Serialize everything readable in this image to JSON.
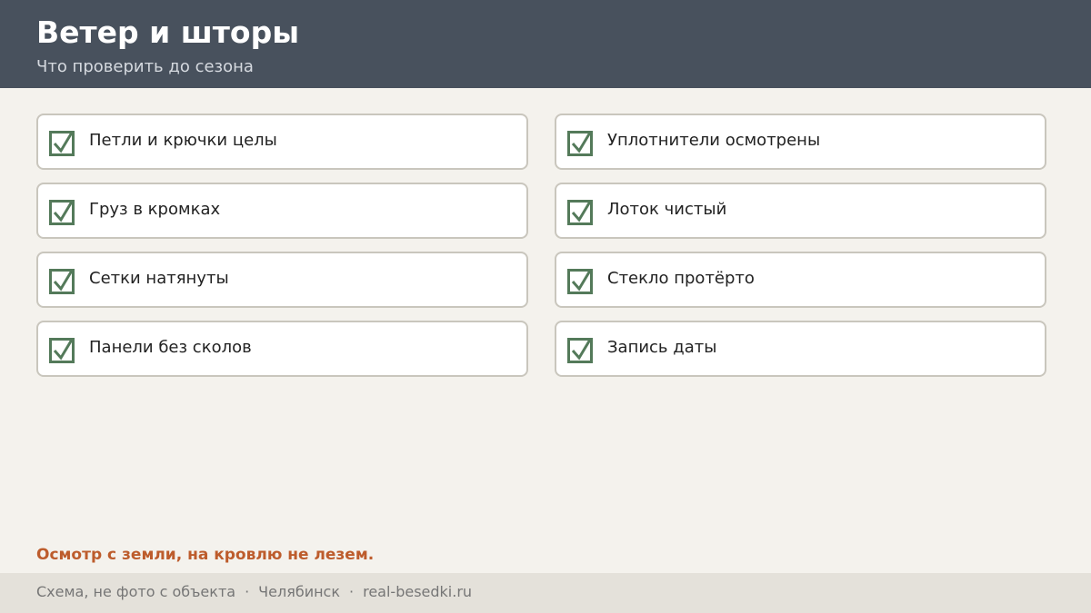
{
  "header": {
    "title": "Ветер и шторы",
    "subtitle": "Что проверить до сезона"
  },
  "checklist": [
    {
      "label": "Петли и крючки целы",
      "checked": true
    },
    {
      "label": "Груз в кромках",
      "checked": true
    },
    {
      "label": "Сетки натянуты",
      "checked": true
    },
    {
      "label": "Панели без сколов",
      "checked": true
    },
    {
      "label": "Уплотнители осмотрены",
      "checked": true
    },
    {
      "label": "Лоток чистый",
      "checked": true
    },
    {
      "label": "Стекло протёрто",
      "checked": true
    },
    {
      "label": "Запись даты",
      "checked": true
    }
  ],
  "note": "Осмотр с земли, на кровлю не лезем.",
  "footer": {
    "items": [
      "Схема, не фото с объекта",
      "Челябинск",
      "real-besedki.ru"
    ],
    "separator": "·"
  },
  "colors": {
    "header_bg": "#48515d",
    "check": "#547a5a",
    "note": "#bd5c2c",
    "page_bg": "#f4f2ed",
    "footer_bg": "#e4e1da"
  }
}
